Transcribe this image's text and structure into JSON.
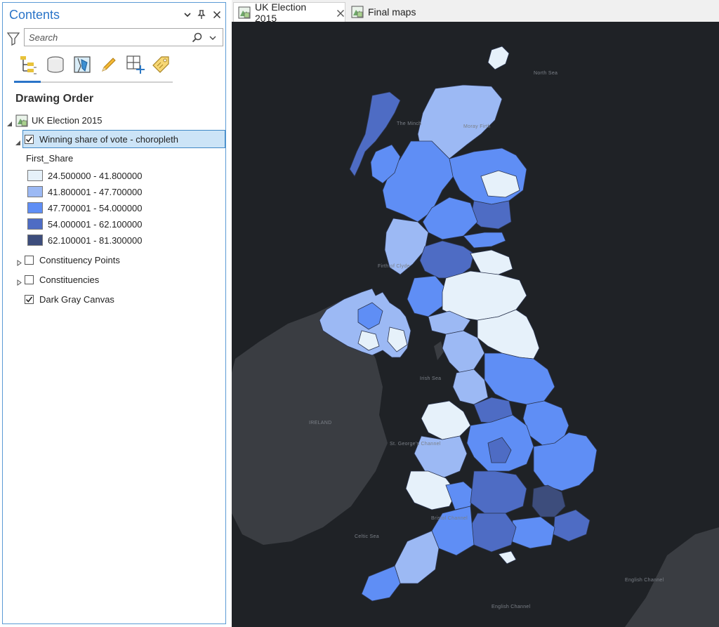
{
  "contents": {
    "title": "Contents",
    "header_buttons": [
      "chevron-down-icon",
      "pin-icon",
      "close-icon"
    ],
    "search": {
      "placeholder": "Search",
      "value": ""
    },
    "view_tabs": [
      {
        "name": "list-by-drawing-order-tab",
        "icon": "drawing-order-icon",
        "selected": true
      },
      {
        "name": "list-by-source-tab",
        "icon": "data-source-icon",
        "selected": false
      },
      {
        "name": "list-by-selection-tab",
        "icon": "selection-icon",
        "selected": false
      },
      {
        "name": "list-by-editing-tab",
        "icon": "pencil-icon",
        "selected": false
      },
      {
        "name": "list-by-snapping-tab",
        "icon": "snapping-icon",
        "selected": false
      },
      {
        "name": "list-by-labeling-tab",
        "icon": "label-tag-icon",
        "selected": false
      }
    ],
    "section_heading": "Drawing Order",
    "map_name": "UK Election 2015",
    "layers": {
      "choropleth": {
        "label": "Winning share of vote - choropleth",
        "checked": true,
        "expanded": true
      },
      "field_name": "First_Share",
      "legend": [
        {
          "label": "24.500000 - 41.800000",
          "color": "#e6f1fa"
        },
        {
          "label": "41.800001 - 47.700000",
          "color": "#9cb9f4"
        },
        {
          "label": "47.700001 - 54.000000",
          "color": "#5f8ef5"
        },
        {
          "label": "54.000001 - 62.100000",
          "color": "#4e6cc4"
        },
        {
          "label": "62.100001 - 81.300000",
          "color": "#3d4d7c"
        }
      ],
      "points": {
        "label": "Constituency Points",
        "checked": false,
        "expanded": false
      },
      "constituencies": {
        "label": "Constituencies",
        "checked": false,
        "expanded": false
      },
      "basemap": {
        "label": "Dark Gray Canvas",
        "checked": true
      }
    }
  },
  "tabs": [
    {
      "label": "UK Election 2015",
      "active": true,
      "closable": true
    },
    {
      "label": "Final maps",
      "active": false,
      "closable": false
    }
  ],
  "map": {
    "background_color": "#1f2226",
    "land_color": "#3a3d42",
    "labels": {
      "north_sea": "North Sea",
      "the_minch": "The Minch",
      "moray_firth": "Moray Firth",
      "firth_of_clyde": "Firth of Clyde",
      "irish_sea": "Irish Sea",
      "ireland": "IRELAND",
      "st_georges_channel": "St. George's Channel",
      "bristol_channel": "Bristol Channel",
      "celtic_sea": "Celtic Sea",
      "english_channel": "English Channel",
      "english_channel_2": "English Channel"
    }
  }
}
